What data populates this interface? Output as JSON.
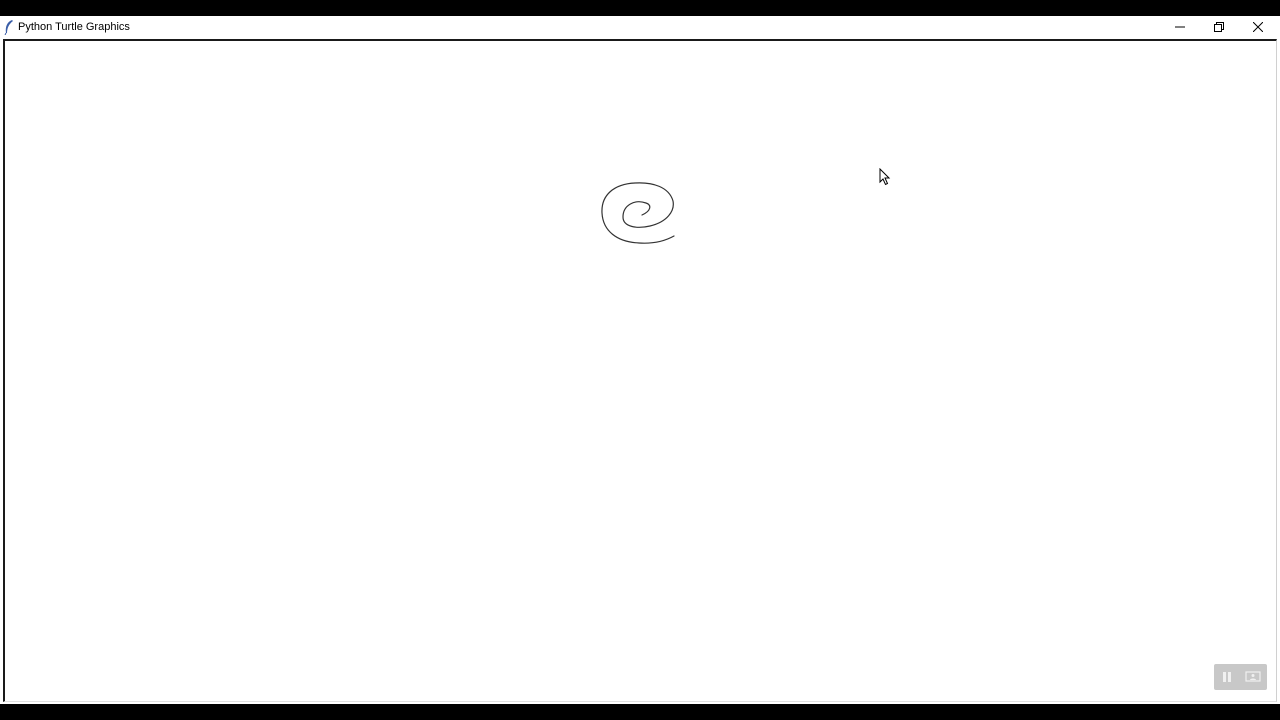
{
  "window": {
    "title": "Python Turtle Graphics",
    "icon": "feather-icon",
    "controls": {
      "minimize_icon": "minimize-icon",
      "maximize_icon": "restore-icon",
      "close_icon": "close-icon"
    }
  },
  "canvas": {
    "background": "#ffffff",
    "stroke_color": "#333333",
    "drawing": "spiral"
  },
  "overlay": {
    "pause_icon": "pause-icon",
    "screen_icon": "presentation-icon"
  }
}
